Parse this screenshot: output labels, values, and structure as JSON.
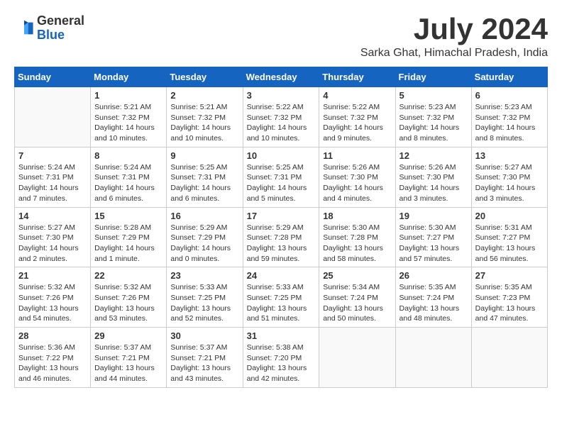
{
  "header": {
    "logo_line1": "General",
    "logo_line2": "Blue",
    "month": "July 2024",
    "location": "Sarka Ghat, Himachal Pradesh, India"
  },
  "weekdays": [
    "Sunday",
    "Monday",
    "Tuesday",
    "Wednesday",
    "Thursday",
    "Friday",
    "Saturday"
  ],
  "weeks": [
    [
      {
        "day": "",
        "info": ""
      },
      {
        "day": "1",
        "info": "Sunrise: 5:21 AM\nSunset: 7:32 PM\nDaylight: 14 hours\nand 10 minutes."
      },
      {
        "day": "2",
        "info": "Sunrise: 5:21 AM\nSunset: 7:32 PM\nDaylight: 14 hours\nand 10 minutes."
      },
      {
        "day": "3",
        "info": "Sunrise: 5:22 AM\nSunset: 7:32 PM\nDaylight: 14 hours\nand 10 minutes."
      },
      {
        "day": "4",
        "info": "Sunrise: 5:22 AM\nSunset: 7:32 PM\nDaylight: 14 hours\nand 9 minutes."
      },
      {
        "day": "5",
        "info": "Sunrise: 5:23 AM\nSunset: 7:32 PM\nDaylight: 14 hours\nand 8 minutes."
      },
      {
        "day": "6",
        "info": "Sunrise: 5:23 AM\nSunset: 7:32 PM\nDaylight: 14 hours\nand 8 minutes."
      }
    ],
    [
      {
        "day": "7",
        "info": "Sunrise: 5:24 AM\nSunset: 7:31 PM\nDaylight: 14 hours\nand 7 minutes."
      },
      {
        "day": "8",
        "info": "Sunrise: 5:24 AM\nSunset: 7:31 PM\nDaylight: 14 hours\nand 6 minutes."
      },
      {
        "day": "9",
        "info": "Sunrise: 5:25 AM\nSunset: 7:31 PM\nDaylight: 14 hours\nand 6 minutes."
      },
      {
        "day": "10",
        "info": "Sunrise: 5:25 AM\nSunset: 7:31 PM\nDaylight: 14 hours\nand 5 minutes."
      },
      {
        "day": "11",
        "info": "Sunrise: 5:26 AM\nSunset: 7:30 PM\nDaylight: 14 hours\nand 4 minutes."
      },
      {
        "day": "12",
        "info": "Sunrise: 5:26 AM\nSunset: 7:30 PM\nDaylight: 14 hours\nand 3 minutes."
      },
      {
        "day": "13",
        "info": "Sunrise: 5:27 AM\nSunset: 7:30 PM\nDaylight: 14 hours\nand 3 minutes."
      }
    ],
    [
      {
        "day": "14",
        "info": "Sunrise: 5:27 AM\nSunset: 7:30 PM\nDaylight: 14 hours\nand 2 minutes."
      },
      {
        "day": "15",
        "info": "Sunrise: 5:28 AM\nSunset: 7:29 PM\nDaylight: 14 hours\nand 1 minute."
      },
      {
        "day": "16",
        "info": "Sunrise: 5:29 AM\nSunset: 7:29 PM\nDaylight: 14 hours\nand 0 minutes."
      },
      {
        "day": "17",
        "info": "Sunrise: 5:29 AM\nSunset: 7:28 PM\nDaylight: 13 hours\nand 59 minutes."
      },
      {
        "day": "18",
        "info": "Sunrise: 5:30 AM\nSunset: 7:28 PM\nDaylight: 13 hours\nand 58 minutes."
      },
      {
        "day": "19",
        "info": "Sunrise: 5:30 AM\nSunset: 7:27 PM\nDaylight: 13 hours\nand 57 minutes."
      },
      {
        "day": "20",
        "info": "Sunrise: 5:31 AM\nSunset: 7:27 PM\nDaylight: 13 hours\nand 56 minutes."
      }
    ],
    [
      {
        "day": "21",
        "info": "Sunrise: 5:32 AM\nSunset: 7:26 PM\nDaylight: 13 hours\nand 54 minutes."
      },
      {
        "day": "22",
        "info": "Sunrise: 5:32 AM\nSunset: 7:26 PM\nDaylight: 13 hours\nand 53 minutes."
      },
      {
        "day": "23",
        "info": "Sunrise: 5:33 AM\nSunset: 7:25 PM\nDaylight: 13 hours\nand 52 minutes."
      },
      {
        "day": "24",
        "info": "Sunrise: 5:33 AM\nSunset: 7:25 PM\nDaylight: 13 hours\nand 51 minutes."
      },
      {
        "day": "25",
        "info": "Sunrise: 5:34 AM\nSunset: 7:24 PM\nDaylight: 13 hours\nand 50 minutes."
      },
      {
        "day": "26",
        "info": "Sunrise: 5:35 AM\nSunset: 7:24 PM\nDaylight: 13 hours\nand 48 minutes."
      },
      {
        "day": "27",
        "info": "Sunrise: 5:35 AM\nSunset: 7:23 PM\nDaylight: 13 hours\nand 47 minutes."
      }
    ],
    [
      {
        "day": "28",
        "info": "Sunrise: 5:36 AM\nSunset: 7:22 PM\nDaylight: 13 hours\nand 46 minutes."
      },
      {
        "day": "29",
        "info": "Sunrise: 5:37 AM\nSunset: 7:21 PM\nDaylight: 13 hours\nand 44 minutes."
      },
      {
        "day": "30",
        "info": "Sunrise: 5:37 AM\nSunset: 7:21 PM\nDaylight: 13 hours\nand 43 minutes."
      },
      {
        "day": "31",
        "info": "Sunrise: 5:38 AM\nSunset: 7:20 PM\nDaylight: 13 hours\nand 42 minutes."
      },
      {
        "day": "",
        "info": ""
      },
      {
        "day": "",
        "info": ""
      },
      {
        "day": "",
        "info": ""
      }
    ]
  ]
}
